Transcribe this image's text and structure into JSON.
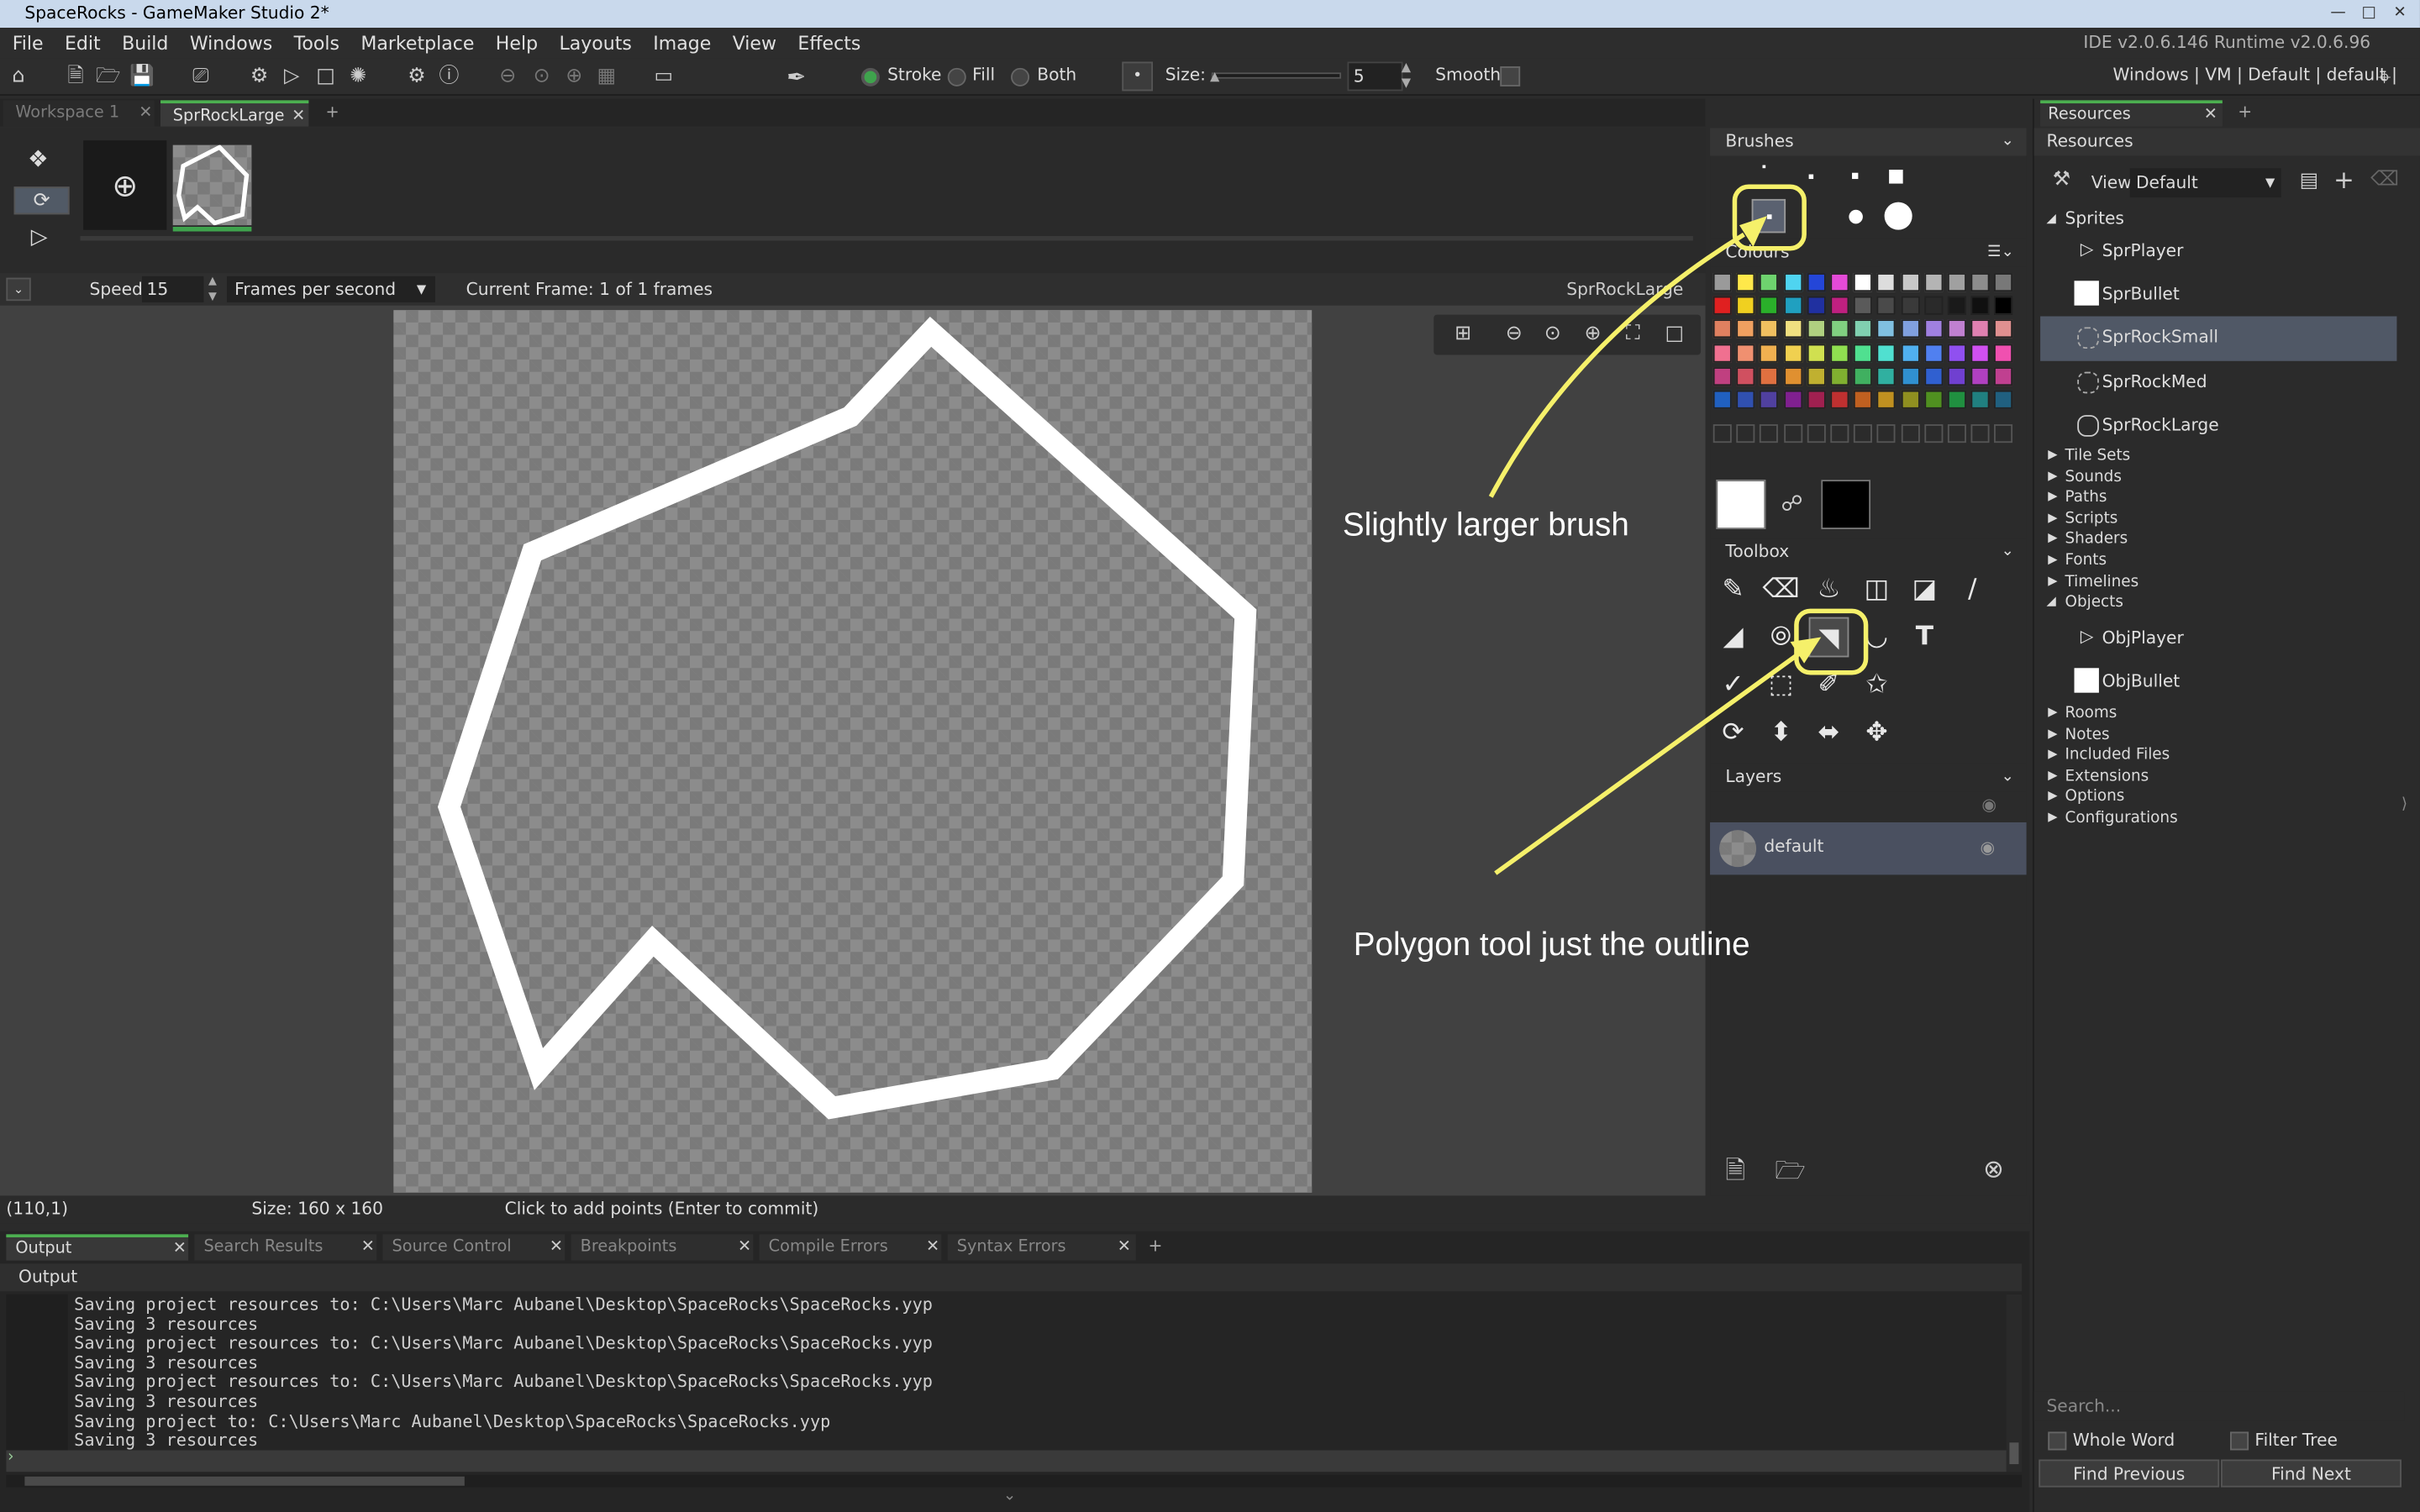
{
  "window": {
    "title": "SpaceRocks - GameMaker Studio 2*",
    "ide_version": "IDE v2.0.6.146 Runtime v2.0.6.96"
  },
  "menu": [
    "File",
    "Edit",
    "Build",
    "Windows",
    "Tools",
    "Marketplace",
    "Help",
    "Layouts",
    "Image",
    "View",
    "Effects"
  ],
  "toolbar": {
    "stroke_label": "Stroke",
    "fill_label": "Fill",
    "both_label": "Both",
    "size_label": "Size:",
    "size_value": "5",
    "smooth_label": "Smooth",
    "target": "Windows | VM | Default | default |",
    "selected_mode": "Stroke"
  },
  "tabs": [
    {
      "label": "Workspace 1"
    },
    {
      "label": "SprRockLarge"
    }
  ],
  "frame_bar": {
    "speed_label": "Speed:",
    "speed_value": "15",
    "fps_option": "Frames per second",
    "current_frame": "Current Frame: 1 of 1 frames",
    "sprite_name": "SprRockLarge"
  },
  "status": {
    "coords": "(110,1)",
    "size": "Size: 160 x 160",
    "hint": "Click to add points (Enter to commit)"
  },
  "brushes": {
    "title": "Brushes"
  },
  "colours": {
    "title": "Colours",
    "primary": "#ffffff",
    "secondary": "#000000"
  },
  "toolbox": {
    "title": "Toolbox",
    "selected_tool": "polygon"
  },
  "layers": {
    "title": "Layers",
    "items": [
      "default"
    ]
  },
  "resources": {
    "tab": "Resources",
    "header": "Resources",
    "view_label": "View",
    "view_value": "Default",
    "groups": {
      "sprites": "Sprites",
      "sprites_items": [
        "SprPlayer",
        "SprBullet",
        "SprRockSmall",
        "SprRockMed",
        "SprRockLarge"
      ],
      "mid": [
        "Tile Sets",
        "Sounds",
        "Paths",
        "Scripts",
        "Shaders",
        "Fonts",
        "Timelines"
      ],
      "objects": "Objects",
      "objects_items": [
        "ObjPlayer",
        "ObjBullet"
      ],
      "rest": [
        "Rooms",
        "Notes",
        "Included Files",
        "Extensions",
        "Options",
        "Configurations"
      ]
    },
    "selected": "SprRockSmall",
    "search_placeholder": "Search...",
    "whole_word": "Whole Word",
    "filter_tree": "Filter Tree",
    "find_previous": "Find Previous",
    "find_next": "Find Next"
  },
  "output_tabs": [
    "Output",
    "Search Results",
    "Source Control",
    "Breakpoints",
    "Compile Errors",
    "Syntax Errors"
  ],
  "output": {
    "title": "Output",
    "lines": [
      "Saving project resources to: C:\\Users\\Marc Aubanel\\Desktop\\SpaceRocks\\SpaceRocks.yyp",
      "Saving 3 resources",
      "Saving project resources to: C:\\Users\\Marc Aubanel\\Desktop\\SpaceRocks\\SpaceRocks.yyp",
      "Saving 3 resources",
      "Saving project resources to: C:\\Users\\Marc Aubanel\\Desktop\\SpaceRocks\\SpaceRocks.yyp",
      "Saving 3 resources",
      "Saving project to: C:\\Users\\Marc Aubanel\\Desktop\\SpaceRocks\\SpaceRocks.yyp",
      "Saving 3 resources"
    ]
  },
  "annotations": {
    "brush": "Slightly larger brush",
    "polygon": "Polygon tool just the outline",
    "color": "#f5f06a"
  }
}
